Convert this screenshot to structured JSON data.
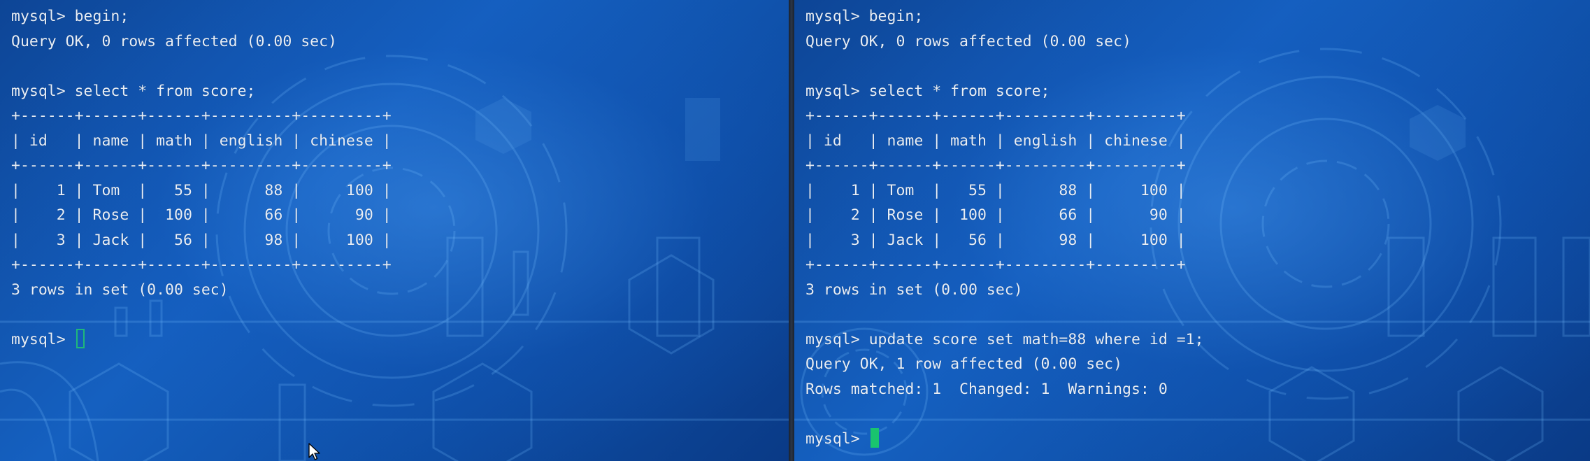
{
  "left_terminal": {
    "lines": [
      "mysql> begin;",
      "Query OK, 0 rows affected (0.00 sec)",
      "",
      "mysql> select * from score;",
      "+------+------+------+---------+---------+",
      "| id   | name | math | english | chinese |",
      "+------+------+------+---------+---------+",
      "|    1 | Tom  |   55 |      88 |     100 |",
      "|    2 | Rose |  100 |      66 |      90 |",
      "|    3 | Jack |   56 |      98 |     100 |",
      "+------+------+------+---------+---------+",
      "3 rows in set (0.00 sec)",
      ""
    ],
    "prompt": "mysql> "
  },
  "right_terminal": {
    "lines": [
      "mysql> begin;",
      "Query OK, 0 rows affected (0.00 sec)",
      "",
      "mysql> select * from score;",
      "+------+------+------+---------+---------+",
      "| id   | name | math | english | chinese |",
      "+------+------+------+---------+---------+",
      "|    1 | Tom  |   55 |      88 |     100 |",
      "|    2 | Rose |  100 |      66 |      90 |",
      "|    3 | Jack |   56 |      98 |     100 |",
      "+------+------+------+---------+---------+",
      "3 rows in set (0.00 sec)",
      "",
      "mysql> update score set math=88 where id =1;",
      "Query OK, 1 row affected (0.00 sec)",
      "Rows matched: 1  Changed: 1  Warnings: 0",
      ""
    ],
    "prompt": "mysql> "
  },
  "colors": {
    "text": "#e8eef6",
    "cursor_left": "#1fb87a",
    "cursor_right": "#19c46e",
    "background": "#1560c0"
  },
  "icons": {
    "mouse_pointer": "arrow-cursor-icon"
  }
}
